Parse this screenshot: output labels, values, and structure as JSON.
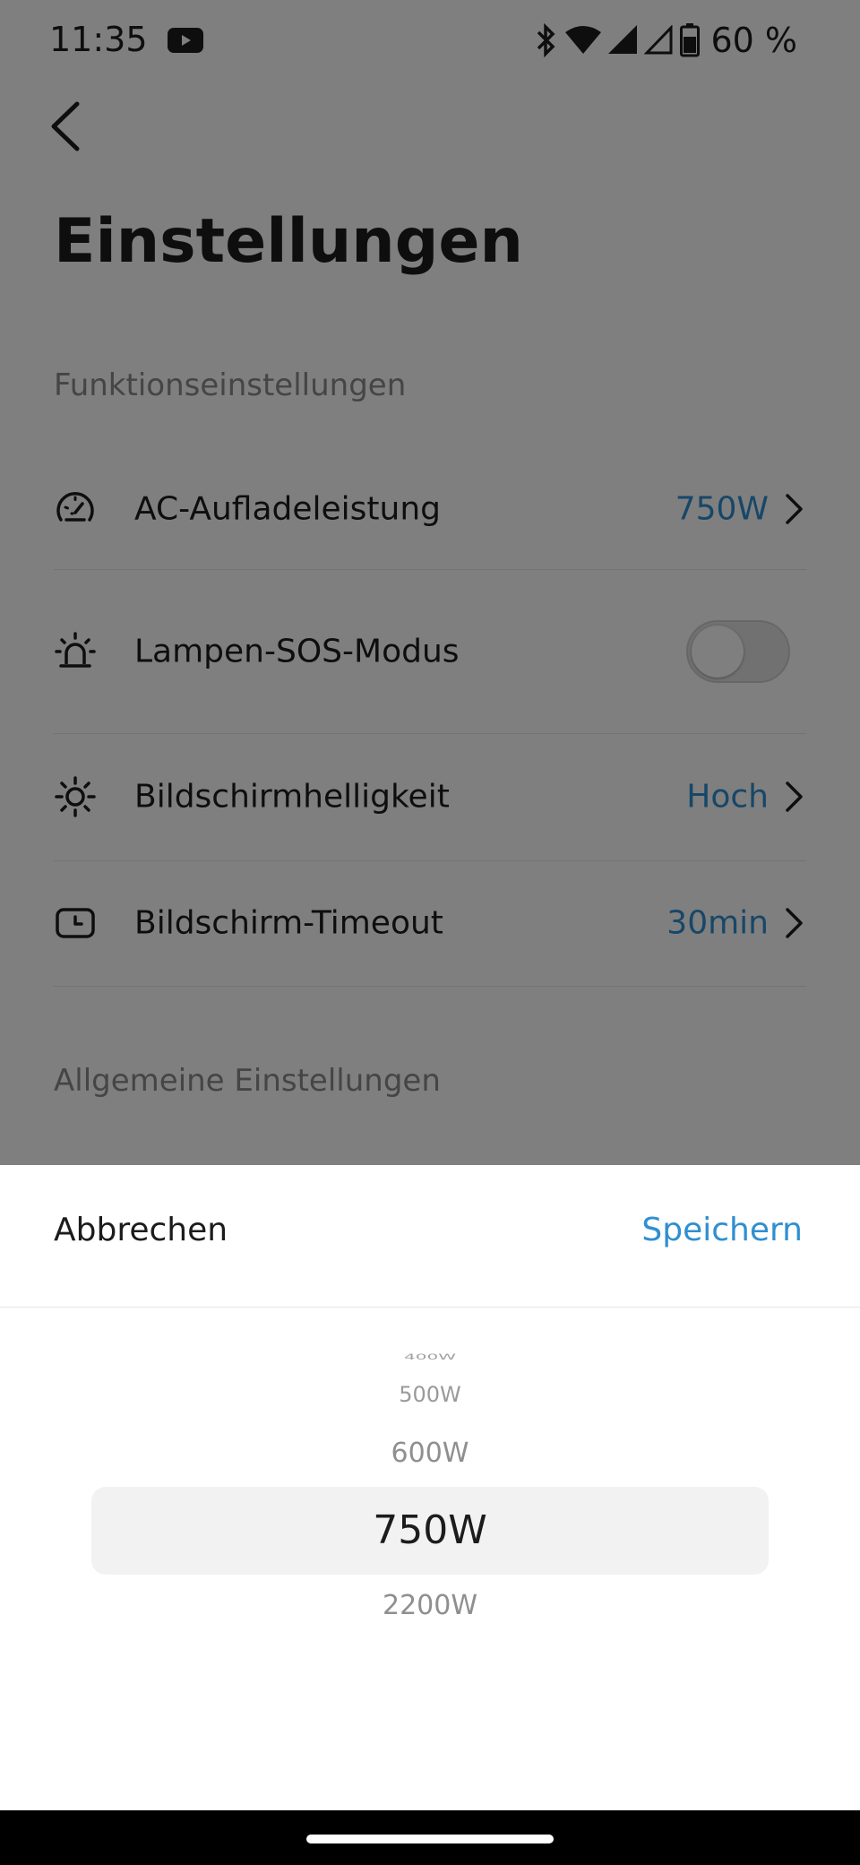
{
  "status_bar": {
    "time": "11:35",
    "battery": "60 %",
    "icons": [
      "youtube-icon",
      "bluetooth-icon",
      "wifi-icon",
      "cell-signal-icon",
      "cell-signal-icon",
      "battery-icon"
    ]
  },
  "header": {
    "title": "Einstellungen"
  },
  "sections": {
    "function": {
      "title": "Funktionseinstellungen"
    },
    "general": {
      "title": "Allgemeine Einstellungen"
    }
  },
  "settings": {
    "ac_charge": {
      "label": "AC-Aufladeleistung",
      "value": "750W",
      "icon": "speedometer-icon"
    },
    "lamp_sos": {
      "label": "Lampen-SOS-Modus",
      "enabled": false,
      "icon": "alarm-light-icon"
    },
    "brightness": {
      "label": "Bildschirmhelligkeit",
      "value": "Hoch",
      "icon": "sun-icon"
    },
    "timeout": {
      "label": "Bildschirm-Timeout",
      "value": "30min",
      "icon": "screen-clock-icon"
    }
  },
  "sheet": {
    "cancel_label": "Abbrechen",
    "save_label": "Speichern",
    "picker": {
      "options": [
        "400W",
        "500W",
        "600W",
        "750W",
        "2200W"
      ],
      "selected": "750W"
    }
  },
  "colors": {
    "accent": "#2f8fd0",
    "text": "#1c1c1c",
    "muted": "#8a8a8a",
    "overlay": "rgba(0,0,0,0.5)"
  }
}
